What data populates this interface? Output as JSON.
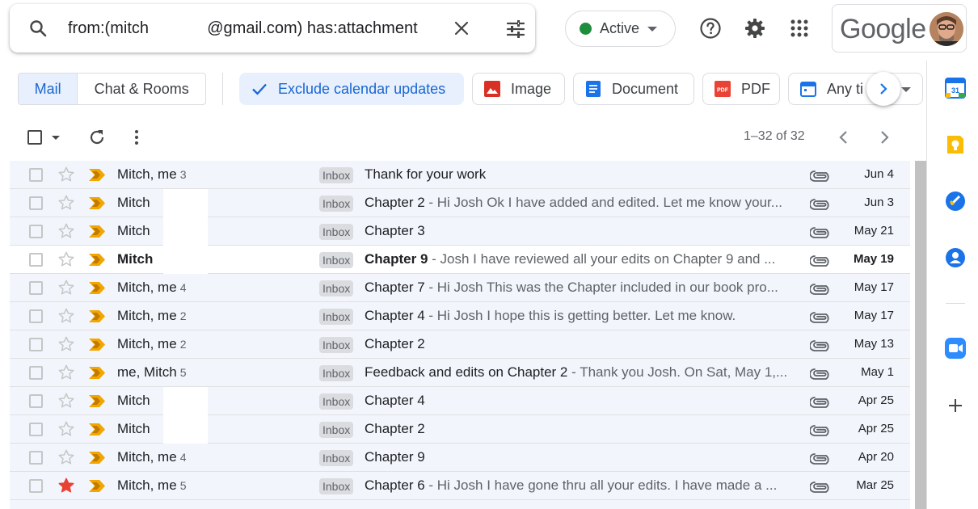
{
  "search": {
    "query": "from:(mitch             @gmail.com) has:attachment",
    "icon": "search-icon",
    "clear_icon": "close-icon",
    "options_icon": "tune-icon"
  },
  "status": {
    "label": "Active",
    "color": "#1e8e3e"
  },
  "header": {
    "logo_text": "Google"
  },
  "tabs": {
    "mail": "Mail",
    "chat": "Chat & Rooms"
  },
  "chips": [
    {
      "label": "Exclude calendar updates",
      "icon": "check-icon",
      "selected": true
    },
    {
      "label": "Image",
      "icon": "image-icon"
    },
    {
      "label": "Document",
      "icon": "document-icon"
    },
    {
      "label": "PDF",
      "icon": "pdf-icon"
    },
    {
      "label": "Any ti",
      "icon": "calendar-icon"
    }
  ],
  "pager": {
    "text": "1–32 of 32"
  },
  "label_text": "Inbox",
  "emails": [
    {
      "sender": "Mitch, me",
      "count": "3",
      "subject": "Thank for your work",
      "snippet": "",
      "date": "Jun 4",
      "unread": false,
      "starred": false
    },
    {
      "sender": "Mitch",
      "count": "",
      "subject": "Chapter 2",
      "snippet": " - Hi Josh Ok I have added and edited. Let me know your...",
      "date": "Jun 3",
      "unread": false,
      "starred": false
    },
    {
      "sender": "Mitch",
      "count": "",
      "subject": "Chapter 3",
      "snippet": "",
      "date": "May 21",
      "unread": false,
      "starred": false
    },
    {
      "sender": "Mitch",
      "count": "",
      "subject": "Chapter 9",
      "snippet": " - Josh I have reviewed all your edits on Chapter 9 and ...",
      "date": "May 19",
      "unread": true,
      "starred": false
    },
    {
      "sender": "Mitch, me",
      "count": "4",
      "subject": "Chapter 7",
      "snippet": " - Hi Josh This was the Chapter included in our book pro...",
      "date": "May 17",
      "unread": false,
      "starred": false
    },
    {
      "sender": "Mitch, me",
      "count": "2",
      "subject": "Chapter 4",
      "snippet": " - Hi Josh I hope this is getting better. Let me know.",
      "date": "May 17",
      "unread": false,
      "starred": false
    },
    {
      "sender": "Mitch, me",
      "count": "2",
      "subject": "Chapter 2",
      "snippet": "",
      "date": "May 13",
      "unread": false,
      "starred": false
    },
    {
      "sender": "me, Mitch",
      "count": "5",
      "subject": "Feedback and edits on Chapter 2",
      "snippet": " - Thank you Josh. On Sat, May 1,...",
      "date": "May 1",
      "unread": false,
      "starred": false
    },
    {
      "sender": "Mitch",
      "count": "",
      "subject": "Chapter 4",
      "snippet": "",
      "date": "Apr 25",
      "unread": false,
      "starred": false
    },
    {
      "sender": "Mitch",
      "count": "",
      "subject": "Chapter 2",
      "snippet": "",
      "date": "Apr 25",
      "unread": false,
      "starred": false
    },
    {
      "sender": "Mitch, me",
      "count": "4",
      "subject": "Chapter 9",
      "snippet": "",
      "date": "Apr 20",
      "unread": false,
      "starred": false
    },
    {
      "sender": "Mitch, me",
      "count": "5",
      "subject": "Chapter 6",
      "snippet": " - Hi Josh I have gone thru all your edits. I have made a ...",
      "date": "Mar 25",
      "unread": false,
      "starred": true
    },
    {
      "sender": "",
      "count": "",
      "subject": "",
      "snippet": "",
      "date": "",
      "unread": false,
      "starred": false
    }
  ],
  "side_panel": [
    "calendar-icon",
    "keep-icon",
    "tasks-icon",
    "contacts-icon",
    "zoom-icon",
    "add-icon"
  ],
  "colors": {
    "accent": "#1a73e8",
    "selected_bg": "#e8f0fe",
    "important": "#f2a600",
    "star_on": "#e94235",
    "read_bg": "#f2f6fc"
  }
}
